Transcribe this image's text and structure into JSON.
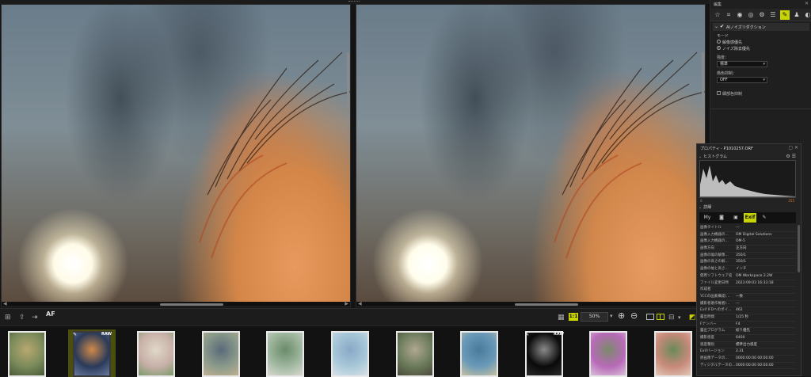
{
  "edit_panel": {
    "title": "編集",
    "tools": [
      "star-icon",
      "crop-icon",
      "color-icon",
      "eye-icon",
      "curve-icon",
      "sliders-icon",
      "noise-icon",
      "stamp-icon",
      "redeye-icon"
    ],
    "section": {
      "label": "AIノイズリダクション"
    },
    "mode": {
      "label": "モード",
      "options": [
        "解像感優先",
        "ノイズ除去優先"
      ],
      "selected_index": 1
    },
    "strength": {
      "label": "強度：",
      "value": "標準"
    },
    "false_color": {
      "label": "偽色抑制：",
      "value": "OFF"
    },
    "edge_suppress": {
      "label": "細部色抑制"
    }
  },
  "properties": {
    "title": "プロパティ - P1010257.ORF",
    "histogram_label": "ヒストグラム",
    "histo_low": "0",
    "histo_high": "255",
    "details_label": "詳細",
    "tabs": [
      "My",
      "camera-icon",
      "image-icon",
      "Exif",
      "edit-icon"
    ],
    "active_tab": "Exif",
    "rows": [
      {
        "k": "画像タイトル",
        "v": "---"
      },
      {
        "k": "画像入力機器の...",
        "v": "OM Digital Solutions"
      },
      {
        "k": "画像入力機器の...",
        "v": "OM-5"
      },
      {
        "k": "画像方向",
        "v": "正方向"
      },
      {
        "k": "画像の幅の解像...",
        "v": "350/1"
      },
      {
        "k": "画像の高さの解...",
        "v": "350/1"
      },
      {
        "k": "画像の幅と高さ...",
        "v": "インチ"
      },
      {
        "k": "使用ソフトウェア名",
        "v": "OM Workspace 2.2W"
      },
      {
        "k": "ファイル変更日時",
        "v": "2023:09:03 16:33:18"
      },
      {
        "k": "作成者",
        "v": ""
      },
      {
        "k": "YCCの画素構成(...",
        "v": "一致"
      },
      {
        "k": "撮影者著作権者/...",
        "v": "---"
      },
      {
        "k": "Exif IFDへのポイ...",
        "v": "462"
      },
      {
        "k": "露出時間",
        "v": "1/25 秒"
      },
      {
        "k": "Fナンバー",
        "v": "F4"
      },
      {
        "k": "露出プログラム",
        "v": "絞り優先"
      },
      {
        "k": "撮影感度",
        "v": "6400"
      },
      {
        "k": "感度種別",
        "v": "標準出力感度"
      },
      {
        "k": "Exifバージョン",
        "v": "2.31"
      },
      {
        "k": "原画像データの...",
        "v": "0000:00:00 00:00:00"
      },
      {
        "k": "ディジタルデータの...",
        "v": "0000:00:00 00:00:00"
      }
    ]
  },
  "viewbar": {
    "af_label": "AF",
    "ratio_label": "1:1",
    "zoom_value": "50%"
  },
  "filmstrip": {
    "raw_badge": "RAW",
    "selected_index": 1,
    "thumbs": [
      {
        "colors": [
          "#7a8a5a",
          "#b8a870",
          "#4a5a3a"
        ]
      },
      {
        "colors": [
          "#2a3a5a",
          "#d08a4a",
          "#6a7aa0"
        ],
        "raw": true,
        "pen": true
      },
      {
        "colors": [
          "#c8b0a8",
          "#e0d8c8",
          "#7a9a6a"
        ]
      },
      {
        "colors": [
          "#8a9a8a",
          "#5a6a7a",
          "#c0b090"
        ]
      },
      {
        "colors": [
          "#a0b8a0",
          "#6a8a6a",
          "#d8d8d0"
        ]
      },
      {
        "colors": [
          "#a8c8d8",
          "#88a8c8",
          "#d8e0e8"
        ]
      },
      {
        "colors": [
          "#6a7a5a",
          "#b0a890",
          "#4a4a3a"
        ]
      },
      {
        "colors": [
          "#6a9ab8",
          "#4a7a9a",
          "#c8c0a0"
        ]
      },
      {
        "colors": [
          "#0a0a0a",
          "#8a8a8a",
          "#2a2a2a"
        ],
        "raw": true,
        "pen": true
      },
      {
        "colors": [
          "#b86ab8",
          "#7a8a6a",
          "#d8c0d8"
        ]
      },
      {
        "colors": [
          "#c88a7a",
          "#6a8a5a",
          "#e0c8b8"
        ]
      }
    ]
  }
}
